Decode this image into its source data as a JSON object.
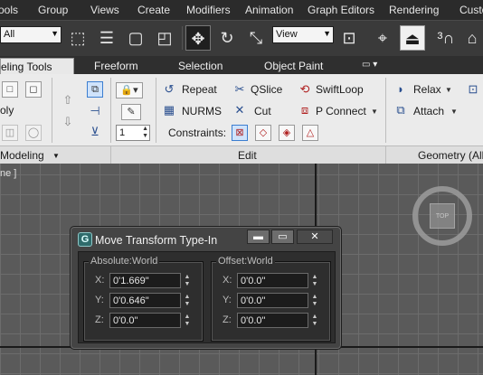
{
  "menu": [
    "ools",
    "Group",
    "Views",
    "Create",
    "Modifiers",
    "Animation",
    "Graph Editors",
    "Rendering",
    "Custo"
  ],
  "toolbar": {
    "selection_filter": "All",
    "ref_coord": "View",
    "icons": [
      "select-object-icon",
      "select-by-name-icon",
      "rect-selection-icon",
      "window-crossing-icon",
      "select-move-icon",
      "select-rotate-icon",
      "select-scale-icon",
      "use-pivot-icon",
      "select-manipulate-icon",
      "keyboard-shortcut-icon",
      "snaps-toggle-icon",
      "angle-snap-icon"
    ]
  },
  "ribbon_tabs": [
    "eling Tools",
    "Freeform",
    "Selection",
    "Object Paint"
  ],
  "ribbon": {
    "poly_label": "oly",
    "spinner_value": "1",
    "edit_tools": {
      "repeat": "Repeat",
      "qslice": "QSlice",
      "swiftloop": "SwiftLoop",
      "nurms": "NURMS",
      "cut": "Cut",
      "p_connect": "P Connect",
      "constraints": "Constraints:"
    },
    "geometry_tools": {
      "relax": "Relax",
      "attach": "Attach"
    },
    "groups": {
      "modeling": "Modeling",
      "edit": "Edit",
      "geometry": "Geometry (All"
    }
  },
  "viewport": {
    "label": "ne ]",
    "viewcube_face": "TOP"
  },
  "dialog": {
    "title": "Move Transform Type-In",
    "absolute": {
      "title": "Absolute:World",
      "x_label": "X:",
      "y_label": "Y:",
      "z_label": "Z:",
      "x": "0'1.669\"",
      "y": "0'0.646\"",
      "z": "0'0.0\""
    },
    "offset": {
      "title": "Offset:World",
      "x_label": "X:",
      "y_label": "Y:",
      "z_label": "Z:",
      "x": "0'0.0\"",
      "y": "0'0.0\"",
      "z": "0'0.0\""
    },
    "window_buttons": {
      "minimize": "▬",
      "restore": "▭",
      "close": "✕"
    }
  },
  "colors": {
    "menubar_bg": "#2b2b2b",
    "toolbar_bg": "#3a3a3a",
    "ribbon_bg": "#ebebeb",
    "viewport_bg": "#5a5a5a",
    "dialog_bg": "#444444",
    "accent_blue": "#2a4f8f"
  }
}
